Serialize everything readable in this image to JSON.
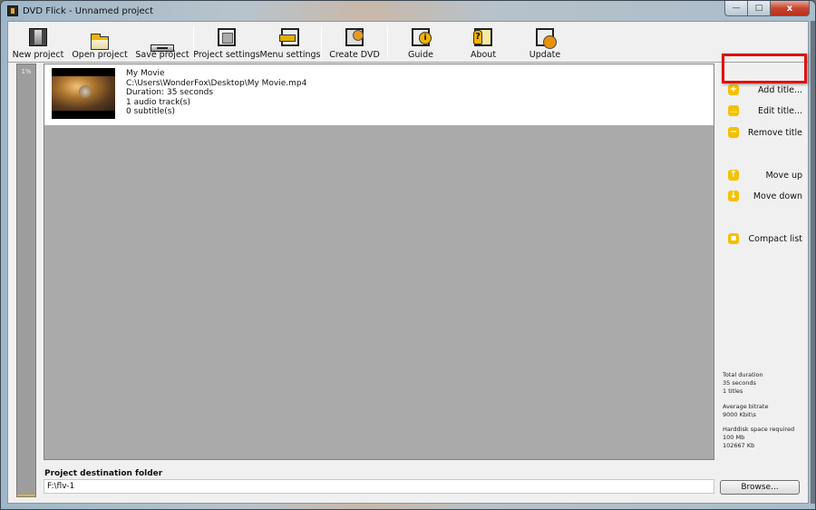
{
  "window": {
    "title": "DVD Flick - Unnamed project",
    "controls": {
      "minimize": "—",
      "maximize": "□",
      "close": "x"
    }
  },
  "toolbar": {
    "buttons": [
      {
        "label": "New project",
        "icon": "film-icon"
      },
      {
        "label": "Open project",
        "icon": "folder-icon"
      },
      {
        "label": "Save project",
        "icon": "drive-icon"
      },
      {
        "label": "Project settings",
        "icon": "project-settings-icon"
      },
      {
        "label": "Menu settings",
        "icon": "menu-settings-icon"
      },
      {
        "label": "Create DVD",
        "icon": "create-dvd-icon"
      },
      {
        "label": "Guide",
        "icon": "guide-icon"
      },
      {
        "label": "About",
        "icon": "about-icon"
      },
      {
        "label": "Update",
        "icon": "update-icon"
      }
    ]
  },
  "progress": {
    "label": "1%",
    "value_percent": 1
  },
  "titles": [
    {
      "name": "My Movie",
      "path": "C:\\Users\\WonderFox\\Desktop\\My Movie.mp4",
      "duration": "Duration: 35 seconds",
      "audio": "1 audio track(s)",
      "subtitles": "0 subtitle(s)"
    }
  ],
  "side_panel": {
    "add_title": "Add title...",
    "edit_title": "Edit title...",
    "remove_title": "Remove title",
    "move_up": "Move up",
    "move_down": "Move down",
    "compact_list": "Compact list",
    "icons": {
      "add": "+",
      "edit": "...",
      "remove": "−",
      "up": "↑",
      "down": "↓",
      "compact": "▪"
    },
    "highlight_color": "#e01010"
  },
  "stats": {
    "total_duration_label": "Total duration",
    "total_duration_value": "35 seconds",
    "titles_count": "1 titles",
    "avg_bitrate_label": "Average bitrate",
    "avg_bitrate_value": "9000 Kbit\\s",
    "disk_label": "Harddisk space required",
    "disk_mb": "100 Mb",
    "disk_kb": "102667 Kb"
  },
  "destination": {
    "label": "Project destination folder",
    "value": "F:\\flv-1",
    "browse_label": "Browse..."
  }
}
